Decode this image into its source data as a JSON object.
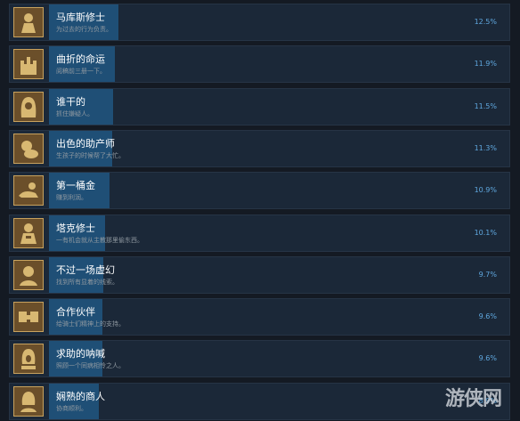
{
  "colors": {
    "background": "#141a23",
    "row_bg": "#1b2838",
    "bar": "#1f4f76",
    "percent": "#5fa7de",
    "icon_bg": "#6b4f2a",
    "icon_border": "#c8a25e"
  },
  "achievements": [
    {
      "name": "马库斯修士",
      "desc": "为过去的行为负责。",
      "percent_label": "12.5%",
      "percent": 12.5,
      "icon": "monk-icon"
    },
    {
      "name": "曲折的命运",
      "desc": "阅稿前三册一下。",
      "percent_label": "11.9%",
      "percent": 11.9,
      "icon": "castle-icon"
    },
    {
      "name": "谁干的",
      "desc": "抓住嫌疑人。",
      "percent_label": "11.5%",
      "percent": 11.5,
      "icon": "hooded-figure-icon"
    },
    {
      "name": "出色的助产师",
      "desc": "生孩子的时候帮了大忙。",
      "percent_label": "11.3%",
      "percent": 11.3,
      "icon": "baby-icon"
    },
    {
      "name": "第一桶金",
      "desc": "赚到利润。",
      "percent_label": "10.9%",
      "percent": 10.9,
      "icon": "coin-hand-icon"
    },
    {
      "name": "塔克修士",
      "desc": "一有机会就从主教那里偷东西。",
      "percent_label": "10.1%",
      "percent": 10.1,
      "icon": "friar-icon"
    },
    {
      "name": "不过一场虚幻",
      "desc": "找到所有显着的线索。",
      "percent_label": "9.7%",
      "percent": 9.7,
      "icon": "portrait-icon"
    },
    {
      "name": "合作伙伴",
      "desc": "给骑士们精神上的支持。",
      "percent_label": "9.6%",
      "percent": 9.6,
      "icon": "handshake-icon"
    },
    {
      "name": "求助的呐喊",
      "desc": "照顾一个同病相怜之人。",
      "percent_label": "9.6%",
      "percent": 9.6,
      "icon": "shouting-woman-icon"
    },
    {
      "name": "娴熟的商人",
      "desc": "协商顺利。",
      "percent_label": "8.9%",
      "percent": 8.9,
      "icon": "merchant-icon"
    }
  ],
  "watermark": "游侠网"
}
